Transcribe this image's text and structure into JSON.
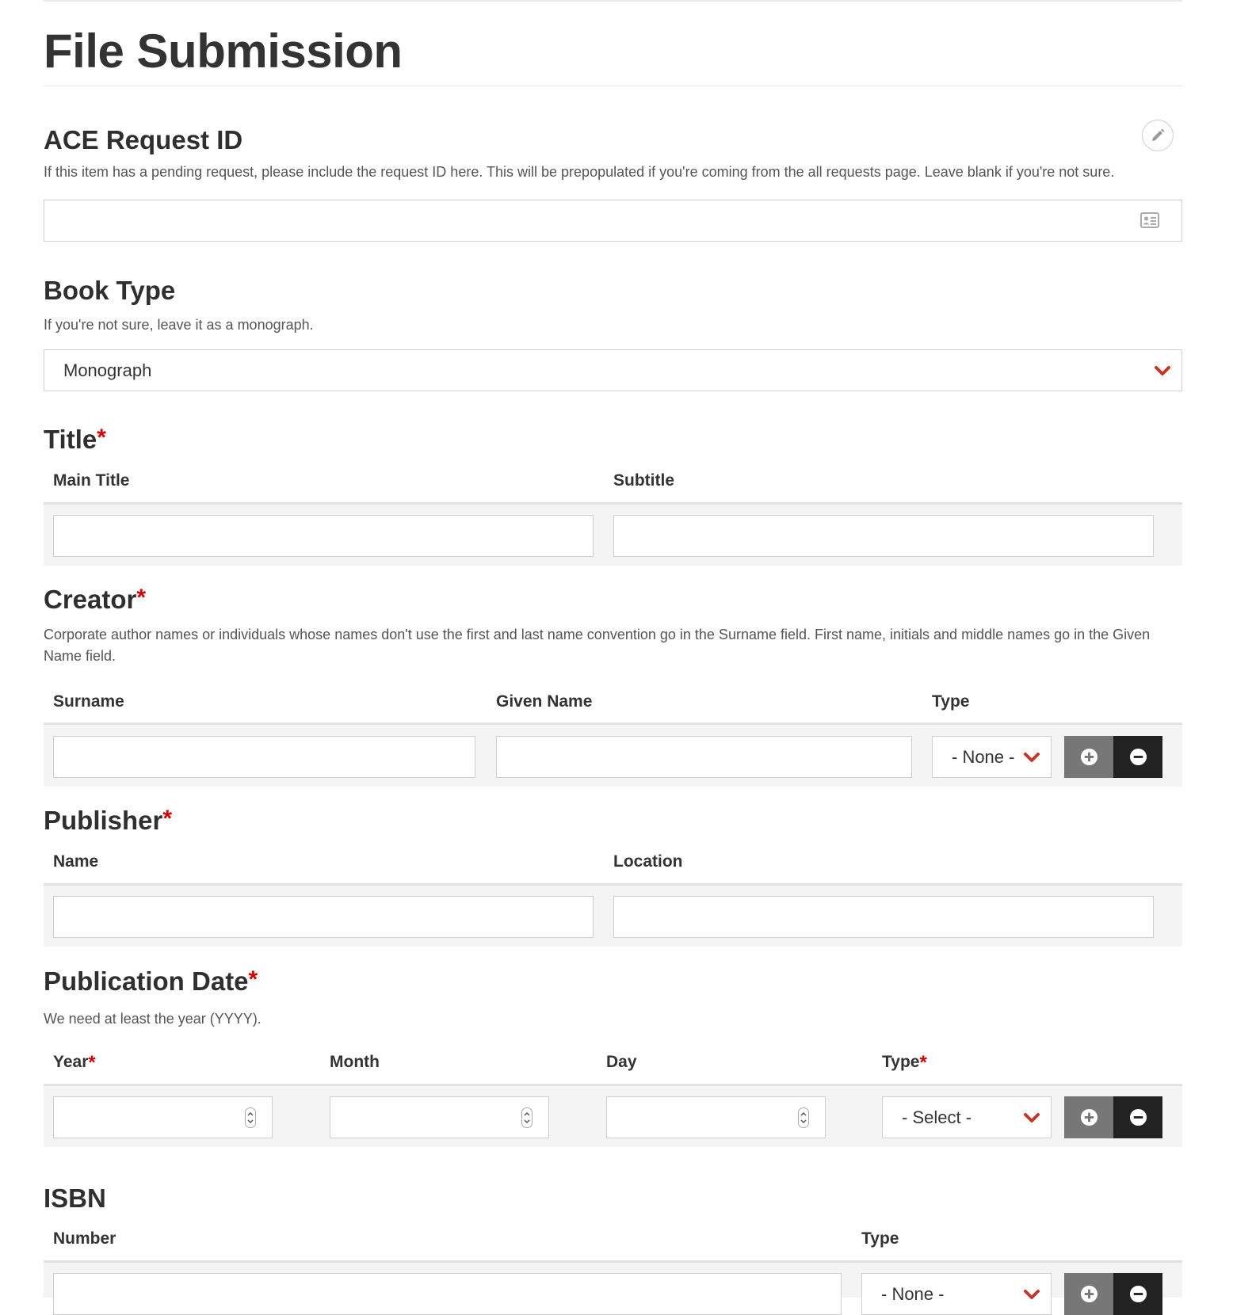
{
  "page": {
    "title": "File Submission"
  },
  "ace": {
    "heading": "ACE Request ID",
    "description": "If this item has a pending request, please include the request ID here. This will be prepopulated if you're coming from the all requests page. Leave blank if you're not sure.",
    "value": "",
    "edit_icon": "pencil-icon",
    "field_icon": "contact-card-icon"
  },
  "book_type": {
    "heading": "Book Type",
    "description": "If you're not sure, leave it as a monograph.",
    "selected": "Monograph"
  },
  "title_section": {
    "heading": "Title",
    "required_mark": "*",
    "columns": [
      "Main Title",
      "Subtitle"
    ]
  },
  "creator": {
    "heading": "Creator",
    "required_mark": "*",
    "description": "Corporate author names or individuals whose names don't use the first and last name convention go in the Surname field.  First name, initials and middle names go in the Given Name field.",
    "columns": [
      "Surname",
      "Given Name",
      "Type"
    ],
    "type_selected": "- None -"
  },
  "publisher": {
    "heading": "Publisher",
    "required_mark": "*",
    "columns": [
      "Name",
      "Location"
    ]
  },
  "pub_date": {
    "heading": "Publication Date",
    "required_mark": "*",
    "description": "We need at least the year (YYYY).",
    "columns": [
      "Year",
      "Month",
      "Day",
      "Type"
    ],
    "year_required": "*",
    "type_required": "*",
    "type_selected": "- Select -"
  },
  "isbn": {
    "heading": "ISBN",
    "columns": [
      "Number",
      "Type"
    ],
    "type_selected": "- None -"
  },
  "colors": {
    "accent": "#c0392b",
    "required": "#d50000",
    "add_button": "#777777",
    "remove_button": "#222222"
  },
  "icons": {
    "add": "plus-circle-icon",
    "remove": "minus-circle-icon",
    "dropdown": "chevron-down-icon",
    "spinner": "number-spinner-icon"
  }
}
